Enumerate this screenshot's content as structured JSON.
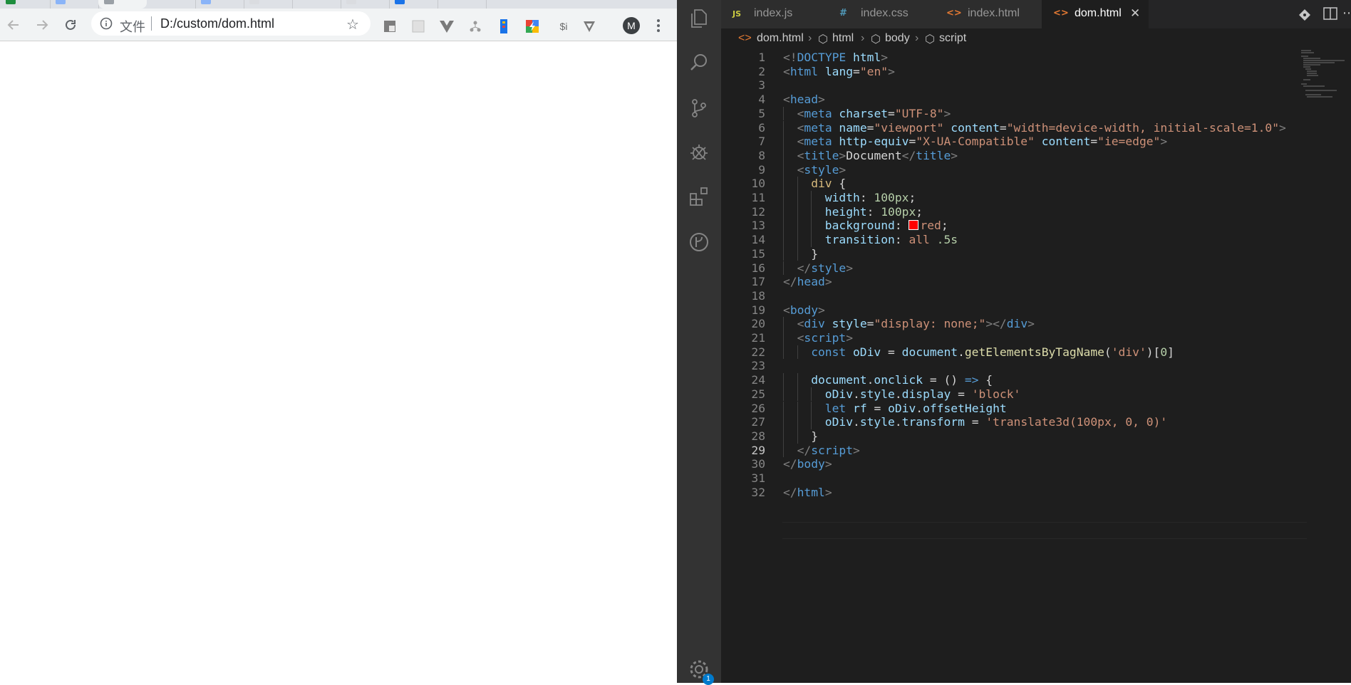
{
  "browser": {
    "address": {
      "scheme_label": "文件",
      "url": "D:/custom/dom.html"
    },
    "extensions": [
      "reader-ext-icon",
      "grid-ext-icon",
      "vue-devtools-icon",
      "tree-ext-icon",
      "ruler-ext-icon",
      "colorful-ext-icon",
      "$i",
      "shield-ext-icon"
    ],
    "profile_initial": "M"
  },
  "vscode": {
    "tabs": [
      {
        "icon": "JS",
        "label": "index.js",
        "active": false
      },
      {
        "icon": "#",
        "label": "index.css",
        "active": false
      },
      {
        "icon": "<>",
        "label": "index.html",
        "active": false
      },
      {
        "icon": "<>",
        "label": "dom.html",
        "active": true
      }
    ],
    "breadcrumbs": [
      "dom.html",
      "html",
      "body",
      "script"
    ],
    "settings_badge": "1",
    "current_line": 29,
    "line_numbers": [
      "1",
      "2",
      "3",
      "4",
      "5",
      "6",
      "7",
      "8",
      "9",
      "10",
      "11",
      "12",
      "13",
      "14",
      "15",
      "16",
      "17",
      "18",
      "19",
      "20",
      "21",
      "22",
      "23",
      "24",
      "25",
      "26",
      "27",
      "28",
      "29",
      "30",
      "31",
      "32"
    ],
    "code": {
      "l1": [
        "<!",
        "DOCTYPE",
        " html",
        ">"
      ],
      "l2": [
        "<",
        "html",
        " lang",
        "=",
        "\"en\"",
        ">"
      ],
      "l4": [
        "<",
        "head",
        ">"
      ],
      "l5": [
        "<",
        "meta",
        " charset",
        "=",
        "\"UTF-8\"",
        ">"
      ],
      "l6": [
        "<",
        "meta",
        " name",
        "=",
        "\"viewport\"",
        " content",
        "=",
        "\"width=device-width, initial-scale=1.0\"",
        ">"
      ],
      "l7": [
        "<",
        "meta",
        " http-equiv",
        "=",
        "\"X-UA-Compatible\"",
        " content",
        "=",
        "\"ie=edge\"",
        ">"
      ],
      "l8": [
        "<",
        "title",
        ">",
        "Document",
        "</",
        "title",
        ">"
      ],
      "l9": [
        "<",
        "style",
        ">"
      ],
      "l10": [
        "div",
        " {"
      ],
      "l11": [
        "width",
        ": ",
        "100px",
        ";"
      ],
      "l12": [
        "height",
        ": ",
        "100px",
        ";"
      ],
      "l13": [
        "background",
        ": ",
        "red",
        ";"
      ],
      "l14": [
        "transition",
        ": ",
        "all",
        " .5s"
      ],
      "l15": [
        "}"
      ],
      "l16": [
        "</",
        "style",
        ">"
      ],
      "l17": [
        "</",
        "head",
        ">"
      ],
      "l19": [
        "<",
        "body",
        ">"
      ],
      "l20": [
        "<",
        "div",
        " style",
        "=",
        "\"display: none;\"",
        "></",
        "div",
        ">"
      ],
      "l21": [
        "<",
        "script",
        ">"
      ],
      "l22": [
        "const",
        " oDiv",
        " = ",
        "document",
        ".",
        "getElementsByTagName",
        "(",
        "'div'",
        ")[",
        "0",
        "]"
      ],
      "l24": [
        "document",
        ".",
        "onclick",
        " = () ",
        "=>",
        " {"
      ],
      "l25": [
        "oDiv",
        ".",
        "style",
        ".",
        "display",
        " = ",
        "'block'"
      ],
      "l26": [
        "let",
        " rf",
        " = ",
        "oDiv",
        ".",
        "offsetHeight"
      ],
      "l27": [
        "oDiv",
        ".",
        "style",
        ".",
        "transform",
        " = ",
        "'translate3d(100px, 0, 0)'"
      ],
      "l28": [
        "}"
      ],
      "l29": [
        "</",
        "script",
        ">"
      ],
      "l30": [
        "</",
        "body",
        ">"
      ],
      "l32": [
        "</",
        "html",
        ">"
      ]
    }
  }
}
